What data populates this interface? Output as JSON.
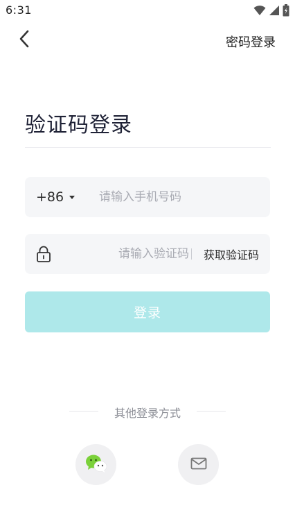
{
  "status_bar": {
    "time": "6:31"
  },
  "header": {
    "back_icon": "chevron-left-icon",
    "switch_label": "密码登录"
  },
  "title": "验证码登录",
  "phone": {
    "country_code": "+86",
    "placeholder": "请输入手机号码",
    "value": ""
  },
  "code": {
    "placeholder": "请输入验证码",
    "value": "",
    "get_code_label": "获取验证码"
  },
  "login_button": {
    "label": "登录",
    "color": "#aee8ea"
  },
  "other_login": {
    "label": "其他登录方式",
    "options": [
      {
        "icon": "wechat-icon"
      },
      {
        "icon": "email-icon"
      }
    ]
  },
  "colors": {
    "accent_wechat": "#7bd13a",
    "field_bg": "#f5f6f8"
  }
}
